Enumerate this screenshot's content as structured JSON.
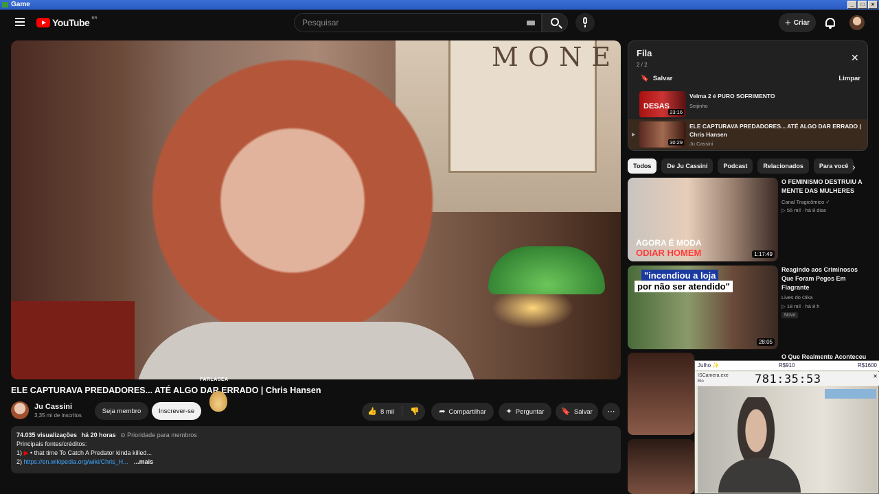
{
  "window": {
    "title": "Game",
    "controls": [
      "_",
      "□",
      "×"
    ]
  },
  "header": {
    "logo_text": "YouTube",
    "logo_region": "BR",
    "search_placeholder": "Pesquisar",
    "create_label": "Criar",
    "icons": [
      "menu-icon",
      "keyboard-icon",
      "search-icon",
      "mic-icon",
      "plus-icon",
      "bell-icon",
      "avatar"
    ]
  },
  "video": {
    "poster_text": "MONE",
    "title": "ELE CAPTURAVA PREDADORES... ATÉ ALGO DAR ERRADO | Chris Hansen",
    "channel": "Ju Cassini",
    "subscribers": "3,35 mi de inscritos",
    "join_label": "Seja membro",
    "subscribe_label": "Inscrever-se",
    "overlay_label": "FARLASEA",
    "likes": "8 mil",
    "share_label": "Compartilhar",
    "ask_label": "Perguntar",
    "save_label": "Salvar"
  },
  "description": {
    "views": "74.035 visualizações",
    "age": "há 20 horas",
    "members": "Prioridade para membros",
    "sources_heading": "Principais fontes/créditos:",
    "line1_num": "1)",
    "line1_text": "• that time To Catch A Predator kinda killed...",
    "line2_num": "2)",
    "line2_link": "https://en.wikipedia.org/wiki/Chris_H...",
    "more_label": "...mais"
  },
  "queue": {
    "title": "Fila",
    "count": "2 / 2",
    "save_label": "Salvar",
    "clear_label": "Limpar",
    "items": [
      {
        "title": "Velma 2 é PURO SOFRIMENTO",
        "channel": "Seijinho",
        "duration": "23:16",
        "thumb_text": "DESAS"
      },
      {
        "title": "ELE CAPTURAVA PREDADORES... ATÉ ALGO DAR ERRADO | Chris Hansen",
        "channel": "Ju Cassini",
        "duration": "30:29",
        "playing": "▶"
      }
    ]
  },
  "chips": [
    "Todos",
    "De Ju Cassini",
    "Podcast",
    "Relacionados",
    "Para você"
  ],
  "recommendations": [
    {
      "title": "O FEMINISMO DESTRUIU A MENTE DAS MULHERES",
      "channel": "Canal Tragicômico",
      "views": "55 mil",
      "age": "há 8 dias",
      "duration": "1:17:49",
      "thumb_text_1": "AGORA É MODA",
      "thumb_text_2": "ODIAR HOMEM"
    },
    {
      "title": "Reagindo aos Criminosos Que Foram Pegos Em Flagrante",
      "channel": "Lives do Oika",
      "views": "18 mil",
      "age": "há 8 h",
      "duration": "28:05",
      "badge": "Novo",
      "thumb_text_1": "\"incendiou a loja",
      "thumb_text_2": "por não ser atendido\""
    },
    {
      "title": "O Que Realmente Aconteceu",
      "channel": "",
      "views": "",
      "age": "",
      "duration": ""
    }
  ],
  "stream_overlay": {
    "name": "Julho ✨",
    "mid_value": "R$910",
    "right_value": "R$1600",
    "camera_label": "ISCamera.exe",
    "off_label": "Elo",
    "timer": "781:35:53"
  }
}
